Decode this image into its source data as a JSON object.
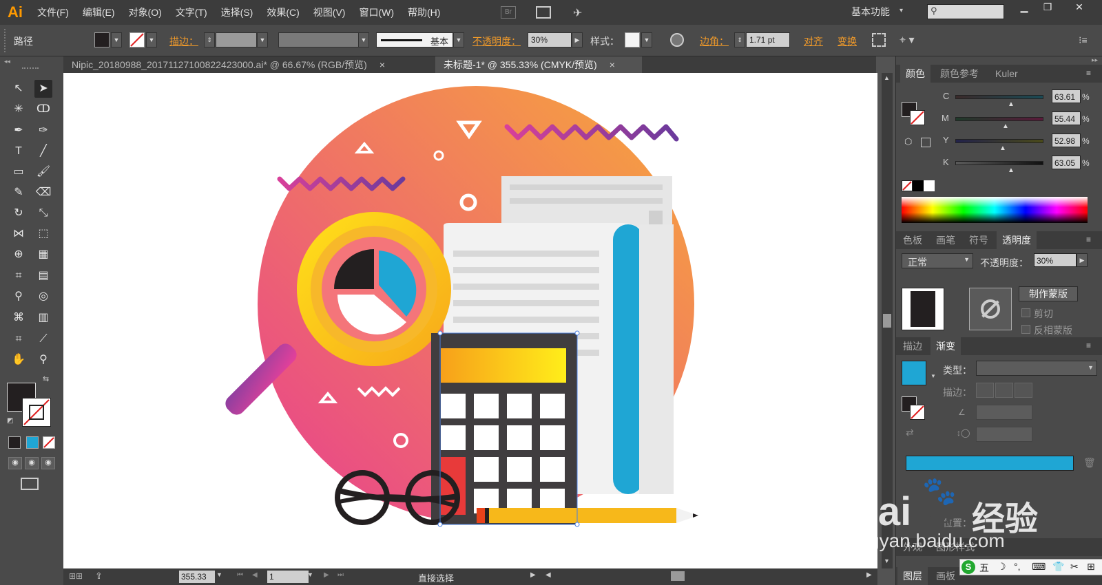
{
  "menubar": {
    "logo": "Ai",
    "items": [
      "文件(F)",
      "编辑(E)",
      "对象(O)",
      "文字(T)",
      "选择(S)",
      "效果(C)",
      "视图(V)",
      "窗口(W)",
      "帮助(H)"
    ],
    "bridge": "Br",
    "workspace": "基本功能"
  },
  "control": {
    "mode": "路径",
    "stroke_label": "描边：",
    "stroke_style": "基本",
    "opacity_label": "不透明度：",
    "opacity_value": "30%",
    "style_label": "样式：",
    "corner_label": "边角：",
    "corner_value": "1.71 pt",
    "align_label": "对齐",
    "transform_label": "变换"
  },
  "tabs": [
    {
      "label": "Nipic_20180988_20171127100822423000.ai* @ 66.67% (RGB/预览)",
      "close": "×"
    },
    {
      "label": "未标题-1* @ 355.33% (CMYK/预览)",
      "close": "×"
    }
  ],
  "status": {
    "zoom": "355.33",
    "page": "1",
    "tool": "直接选择"
  },
  "color_panel": {
    "tabs": [
      "颜色",
      "颜色参考",
      "Kuler"
    ],
    "channels": [
      {
        "name": "C",
        "value": "63.61"
      },
      {
        "name": "M",
        "value": "55.44"
      },
      {
        "name": "Y",
        "value": "52.98"
      },
      {
        "name": "K",
        "value": "63.05"
      }
    ],
    "pct": "%"
  },
  "transparency_panel": {
    "tabs": [
      "色板",
      "画笔",
      "符号",
      "透明度"
    ],
    "blend_mode": "正常",
    "opacity_label": "不透明度：",
    "opacity_value": "30%",
    "make_mask": "制作蒙版",
    "clip": "剪切",
    "invert": "反相蒙版"
  },
  "gradient_panel": {
    "tabs": [
      "描边",
      "渐变"
    ],
    "type_label": "类型：",
    "stroke_label": "描边：",
    "position_label": "位置："
  },
  "bottom_tabs": [
    "外观",
    "图形样式"
  ],
  "layer_tabs": [
    "图层",
    "画板"
  ],
  "watermark": {
    "brand": "Bai",
    "paw": "du",
    "site_cn": "经验",
    "url": "jingyan.baidu.com"
  },
  "ime": {
    "label": "五"
  },
  "colors": {
    "accent": "#ff9a00",
    "cyan": "#1fa6d4",
    "ui_dark": "#3c3c3c",
    "ui_mid": "#4a4a4a"
  }
}
